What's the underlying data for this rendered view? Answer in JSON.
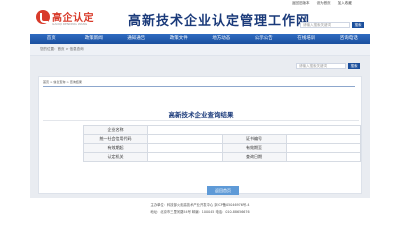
{
  "header": {
    "logo_text": "高企认定",
    "logo_sub": "GAOQI RENDING WANG",
    "site_title": "高新技术企业认定管理工作网",
    "top_links": [
      "返回旧版本",
      "设为首页",
      "加入收藏"
    ],
    "search_placeholder": "请输入搜索关键词",
    "search_button": "搜索"
  },
  "nav": {
    "items": [
      "首页",
      "政策新闻",
      "通知通告",
      "政策文件",
      "地方动态",
      "公示公告",
      "在线培训",
      "咨询电话"
    ]
  },
  "breadcrumb": "您的位置：首页 > 信息查询",
  "inner_search": {
    "placeholder": "请输入搜索关键词",
    "button": "搜索"
  },
  "card": {
    "crumb": "首页 > 信息查询 > 查询结果",
    "title": "高新技术企业查询结果",
    "rows": [
      {
        "label": "企业名称",
        "value": "",
        "label2": "",
        "value2": ""
      },
      {
        "label": "统一社会信用代码",
        "value": "",
        "label2": "证书编号",
        "value2": ""
      },
      {
        "label": "有效期起",
        "value": "",
        "label2": "有效期至",
        "value2": ""
      },
      {
        "label": "认定机关",
        "value": "",
        "label2": "查询日期",
        "value2": ""
      }
    ]
  },
  "back_button": "返回首页",
  "footer": {
    "line1": "主办单位：科技部火炬高技术产业开发中心 京ICP备05046976号-4",
    "line2": "地址：北京市三里河路54号 邮编：100045 电话：010-88656676"
  },
  "colors": {
    "nav_blue": "#1a4f9e",
    "title_blue": "#1a3a7a",
    "logo_red": "#d83a2a",
    "button_blue": "#5e9ad7"
  }
}
